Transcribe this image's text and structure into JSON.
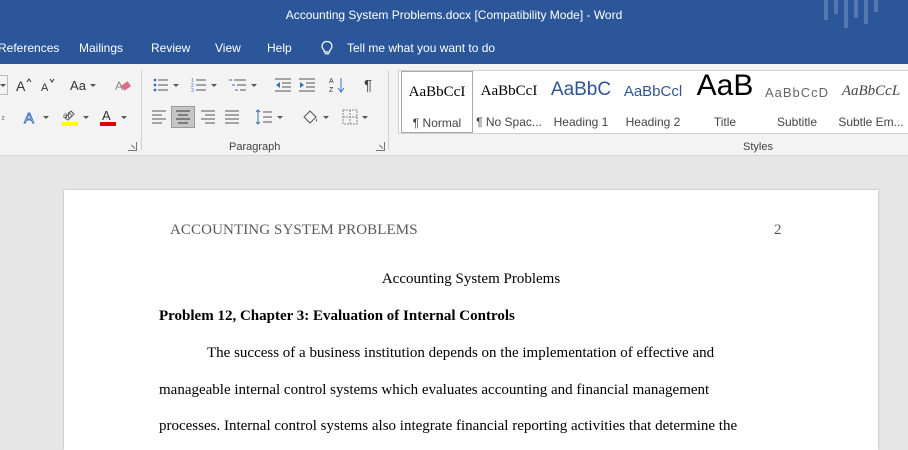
{
  "window": {
    "title": "Accounting System Problems.docx [Compatibility Mode]  -  Word"
  },
  "ribbon_tabs": [
    {
      "label": "References"
    },
    {
      "label": "Mailings"
    },
    {
      "label": "Review"
    },
    {
      "label": "View"
    },
    {
      "label": "Help"
    }
  ],
  "tell_me": {
    "label": "Tell me what you want to do",
    "icon": "lightbulb-icon"
  },
  "font_group": {
    "change_case_label": "Aa"
  },
  "paragraph_group": {
    "label": "Paragraph",
    "selected_alignment": "align-left-icon"
  },
  "styles_group": {
    "label": "Styles",
    "items": [
      {
        "preview": "AaBbCcI",
        "label": "¶ Normal",
        "active": true
      },
      {
        "preview": "AaBbCcI",
        "label": "¶ No Spac..."
      },
      {
        "preview": "AaBbC",
        "label": "Heading 1"
      },
      {
        "preview": "AaBbCcl",
        "label": "Heading 2"
      },
      {
        "preview": "AaB",
        "label": "Title"
      },
      {
        "preview": "AaBbCcD",
        "label": "Subtitle"
      },
      {
        "preview": "AaBbCcL",
        "label": "Subtle Em..."
      }
    ]
  },
  "document": {
    "header_left": "ACCOUNTING SYSTEM PROBLEMS",
    "header_page_number": "2",
    "title": "Accounting System Problems",
    "heading": "Problem 12, Chapter 3: Evaluation of Internal Controls",
    "paragraph_lines": [
      "The success of a business institution depends on the implementation of effective and",
      "manageable internal control systems which evaluates accounting and financial management",
      "processes. Internal control systems also integrate financial reporting activities that determine the"
    ]
  },
  "colors": {
    "word_blue": "#2b579a",
    "ribbon_bg": "#f3f3f3",
    "canvas_bg": "#e6e6e6",
    "heading_blue": "#2f5496"
  }
}
